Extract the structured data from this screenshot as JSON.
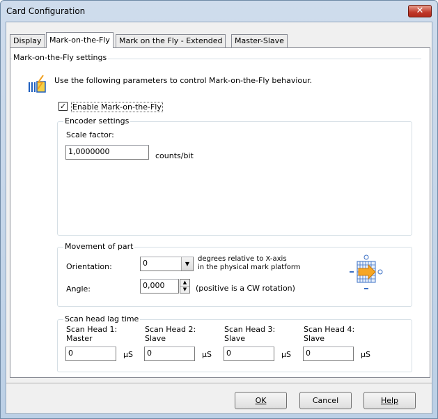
{
  "window": {
    "title": "Card Configuration",
    "close_glyph": "✕"
  },
  "tabs": [
    "Display",
    "Mark-on-the-Fly",
    "Mark on the Fly - Extended",
    "Master-Slave"
  ],
  "mof": {
    "group_title": "Mark-on-the-Fly settings",
    "description": "Use the following parameters to control Mark-on-the-Fly behaviour.",
    "enable_label": "Enable Mark-on-the-Fly",
    "enable_check": "✓"
  },
  "encoder": {
    "group_title": "Encoder settings",
    "scale_label": "Scale factor:",
    "scale_value": "1,0000000",
    "unit": "counts/bit"
  },
  "movement": {
    "group_title": "Movement of part",
    "orientation_label": "Orientation:",
    "orientation_value": "0",
    "orientation_note_1": "degrees relative to X-axis",
    "orientation_note_2": "in the physical mark platform",
    "angle_label": "Angle:",
    "angle_value": "0,000",
    "angle_note": "(positive is a CW rotation)"
  },
  "lag": {
    "group_title": "Scan head lag time",
    "heads": [
      {
        "name": "Scan Head 1:",
        "role": "Master",
        "value": "0",
        "unit": "µS"
      },
      {
        "name": "Scan Head 2:",
        "role": "Slave",
        "value": "0",
        "unit": "µS"
      },
      {
        "name": "Scan Head 3:",
        "role": "Slave",
        "value": "0",
        "unit": "µS"
      },
      {
        "name": "Scan Head 4:",
        "role": "Slave",
        "value": "0",
        "unit": "µS"
      }
    ]
  },
  "buttons": {
    "ok": "OK",
    "cancel": "Cancel",
    "help": "Help"
  }
}
